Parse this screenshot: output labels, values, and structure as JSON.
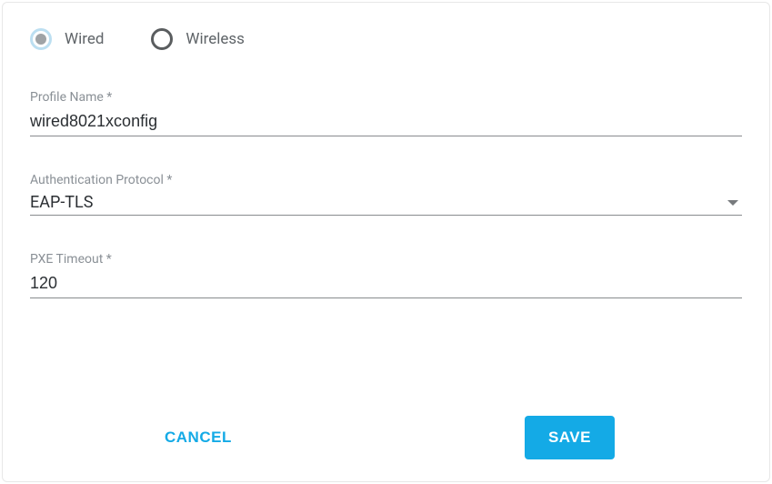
{
  "radios": {
    "wired": {
      "label": "Wired",
      "selected": true
    },
    "wireless": {
      "label": "Wireless",
      "selected": false
    }
  },
  "fields": {
    "profile_name": {
      "label": "Profile Name *",
      "value": "wired8021xconfig"
    },
    "auth_protocol": {
      "label": "Authentication Protocol *",
      "value": "EAP-TLS"
    },
    "pxe_timeout": {
      "label": "PXE Timeout *",
      "value": "120"
    }
  },
  "actions": {
    "cancel": "CANCEL",
    "save": "SAVE"
  }
}
